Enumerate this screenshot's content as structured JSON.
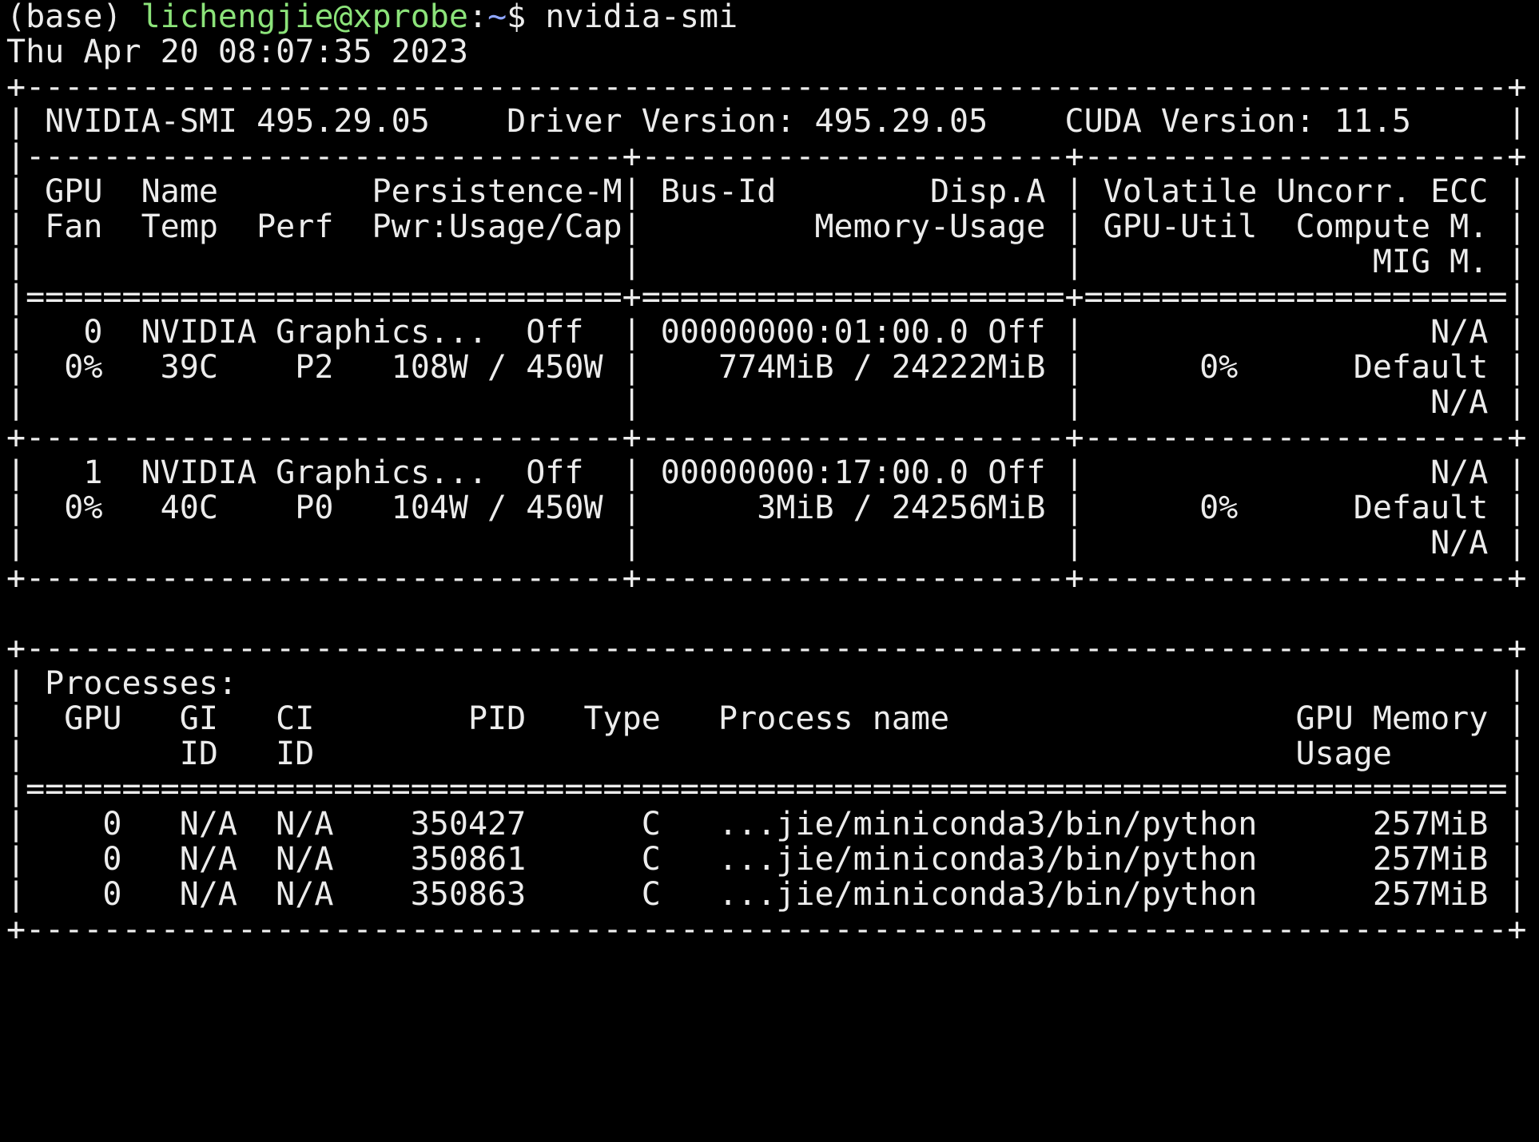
{
  "prompt": {
    "env": "(base) ",
    "user": "lichengjie@xprobe",
    "sep": ":",
    "path": "~",
    "symbol": "$ ",
    "command": "nvidia-smi"
  },
  "colors": {
    "background": "#000000",
    "foreground": "#ececec",
    "user": "#8ce37a",
    "path": "#8fa6ff"
  },
  "output": [
    "Thu Apr 20 08:07:35 2023",
    "+-----------------------------------------------------------------------------+",
    "| NVIDIA-SMI 495.29.05    Driver Version: 495.29.05    CUDA Version: 11.5     |",
    "|-------------------------------+----------------------+----------------------+",
    "| GPU  Name        Persistence-M| Bus-Id        Disp.A | Volatile Uncorr. ECC |",
    "| Fan  Temp  Perf  Pwr:Usage/Cap|         Memory-Usage | GPU-Util  Compute M. |",
    "|                               |                      |               MIG M. |",
    "|===============================+======================+======================|",
    "|   0  NVIDIA Graphics...  Off  | 00000000:01:00.0 Off |                  N/A |",
    "|  0%   39C    P2   108W / 450W |    774MiB / 24222MiB |      0%      Default |",
    "|                               |                      |                  N/A |",
    "+-------------------------------+----------------------+----------------------+",
    "|   1  NVIDIA Graphics...  Off  | 00000000:17:00.0 Off |                  N/A |",
    "|  0%   40C    P0   104W / 450W |      3MiB / 24256MiB |      0%      Default |",
    "|                               |                      |                  N/A |",
    "+-------------------------------+----------------------+----------------------+",
    "",
    "+-----------------------------------------------------------------------------+",
    "| Processes:                                                                  |",
    "|  GPU   GI   CI        PID   Type   Process name                  GPU Memory |",
    "|        ID   ID                                                   Usage      |",
    "|=============================================================================|",
    "|    0   N/A  N/A    350427      C   ...jie/miniconda3/bin/python      257MiB |",
    "|    0   N/A  N/A    350861      C   ...jie/miniconda3/bin/python      257MiB |",
    "|    0   N/A  N/A    350863      C   ...jie/miniconda3/bin/python      257MiB |",
    "+-----------------------------------------------------------------------------+"
  ]
}
